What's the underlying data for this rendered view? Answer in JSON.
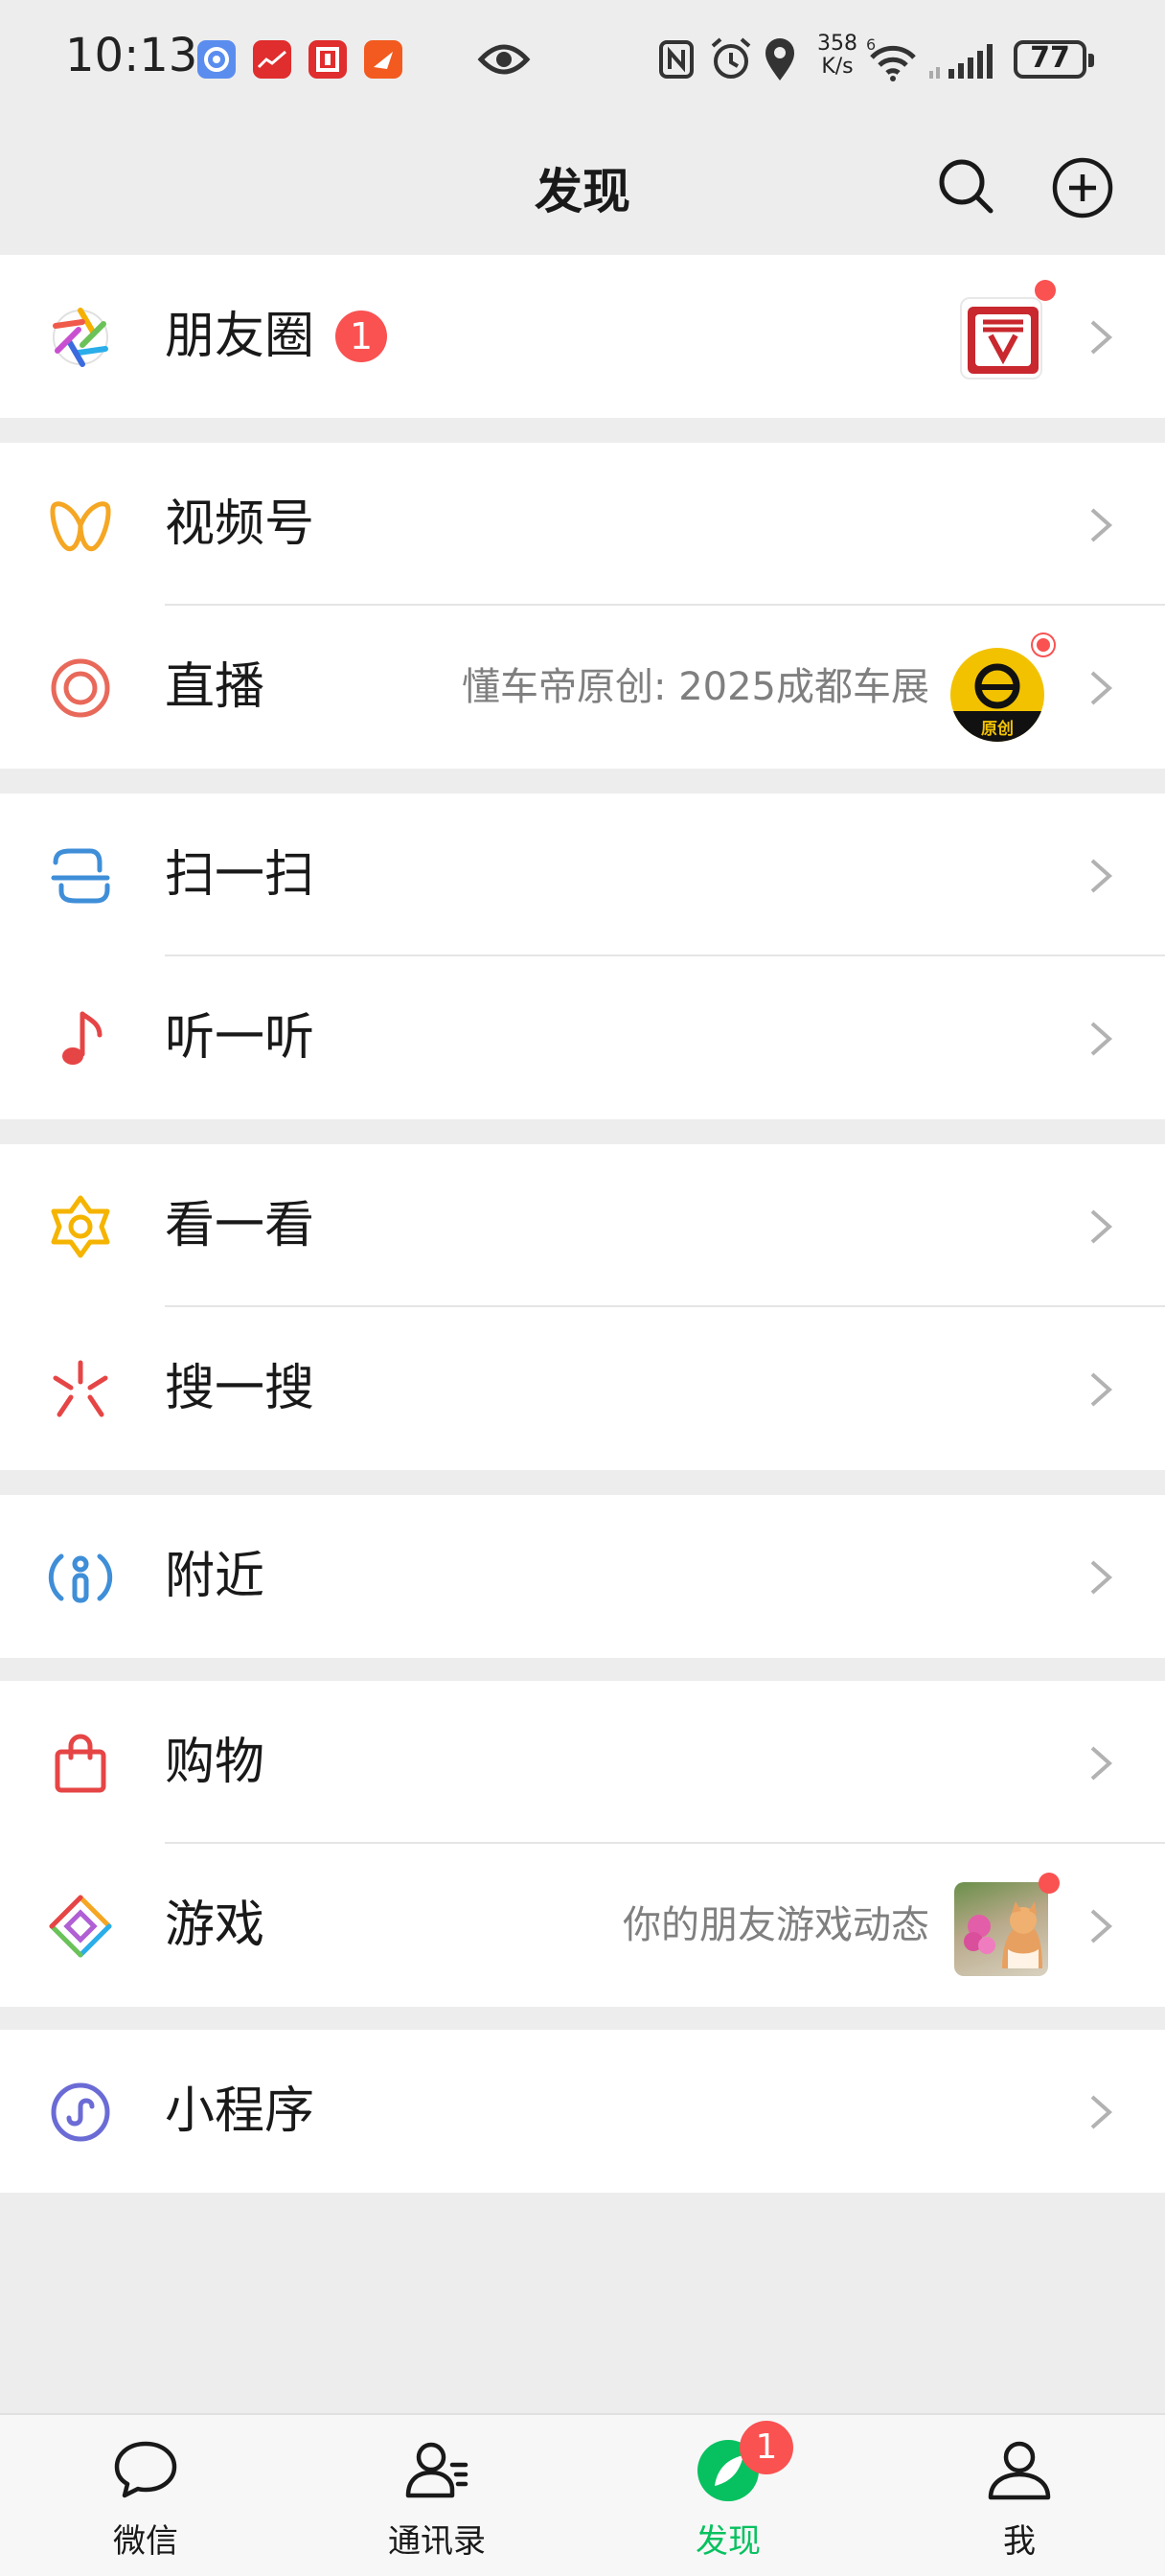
{
  "status_bar": {
    "time": "10:13",
    "net_speed_value": "358",
    "net_speed_unit": "K/s",
    "battery": "77"
  },
  "header": {
    "title": "发现"
  },
  "menu": {
    "moments": {
      "label": "朋友圈",
      "badge": "1"
    },
    "channels": {
      "label": "视频号"
    },
    "live": {
      "label": "直播",
      "subtitle": "懂车帝原创: 2025成都车展",
      "avatar_text": "原创"
    },
    "scan": {
      "label": "扫一扫"
    },
    "listen": {
      "label": "听一听"
    },
    "top_stories": {
      "label": "看一看"
    },
    "search": {
      "label": "搜一搜"
    },
    "nearby": {
      "label": "附近"
    },
    "shopping": {
      "label": "购物"
    },
    "games": {
      "label": "游戏",
      "subtitle": "你的朋友游戏动态"
    },
    "mini_programs": {
      "label": "小程序"
    }
  },
  "tab_bar": {
    "tabs": [
      {
        "label": "微信",
        "icon": "chat-bubble-icon"
      },
      {
        "label": "通讯录",
        "icon": "contacts-icon"
      },
      {
        "label": "发现",
        "icon": "discover-compass-icon",
        "badge": "1",
        "active": true
      },
      {
        "label": "我",
        "icon": "person-icon"
      }
    ]
  },
  "colors": {
    "background": "#ededed",
    "badge_red": "#fa5151",
    "active_green": "#07c160",
    "subtitle_gray": "#7f7f7f"
  }
}
